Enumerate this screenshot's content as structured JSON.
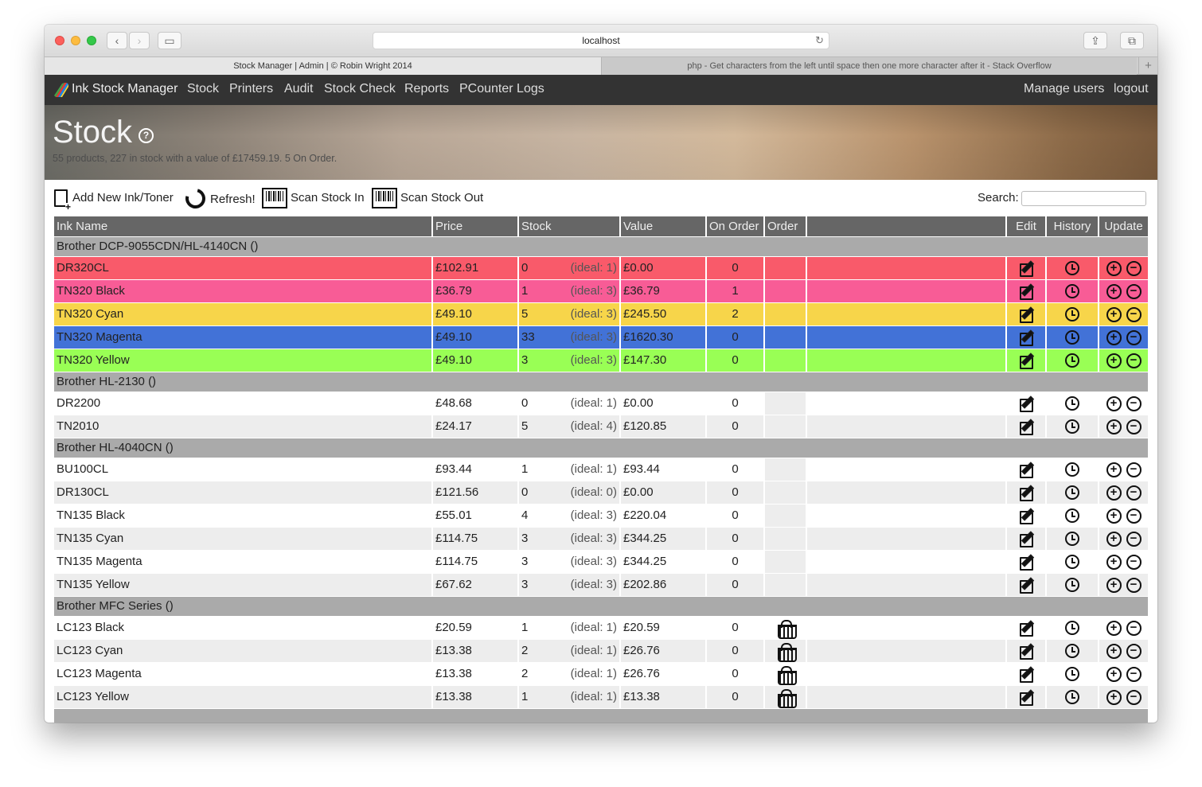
{
  "browser": {
    "url": "localhost",
    "tabs": [
      {
        "label": "Stock Manager | Admin | © Robin Wright 2014",
        "active": true
      },
      {
        "label": "php - Get characters from the left until space then one more character after it - Stack Overflow",
        "active": false
      }
    ]
  },
  "nav": {
    "brand": "Ink Stock Manager",
    "links": [
      "Stock",
      "Printers",
      "Audit",
      "Stock Check",
      "Reports",
      "PCounter Logs"
    ],
    "right_links": [
      "Manage users",
      "logout"
    ]
  },
  "hero": {
    "title": "Stock",
    "help_glyph": "?",
    "summary": "55 products, 227 in stock with a value of £17459.19. 5 On Order."
  },
  "toolbar": {
    "add": "Add New Ink/Toner",
    "refresh": "Refresh!",
    "scan_in": "Scan Stock In",
    "scan_out": "Scan Stock Out",
    "search_label": "Search:",
    "search_value": ""
  },
  "table": {
    "headers": {
      "name": "Ink Name",
      "price": "Price",
      "stock": "Stock",
      "value": "Value",
      "on_order": "On Order",
      "order": "Order",
      "blank": "",
      "edit": "Edit",
      "history": "History",
      "update": "Update"
    },
    "groups": [
      {
        "title": "Brother DCP-9055CDN/HL-4140CN ()",
        "rows": [
          {
            "name": "DR320CL",
            "price": "£102.91",
            "stock": "0",
            "ideal": "(ideal: 1)",
            "value": "£0.00",
            "on_order": "0",
            "color": "#f95a6a",
            "basket": false
          },
          {
            "name": "TN320 Black",
            "price": "£36.79",
            "stock": "1",
            "ideal": "(ideal: 3)",
            "value": "£36.79",
            "on_order": "1",
            "color": "#f85c96",
            "basket": false
          },
          {
            "name": "TN320 Cyan",
            "price": "£49.10",
            "stock": "5",
            "ideal": "(ideal: 3)",
            "value": "£245.50",
            "on_order": "2",
            "color": "#f7d54a",
            "basket": false
          },
          {
            "name": "TN320 Magenta",
            "price": "£49.10",
            "stock": "33",
            "ideal": "(ideal: 3)",
            "value": "£1620.30",
            "on_order": "0",
            "color": "#4272d7",
            "basket": false
          },
          {
            "name": "TN320 Yellow",
            "price": "£49.10",
            "stock": "3",
            "ideal": "(ideal: 3)",
            "value": "£147.30",
            "on_order": "0",
            "color": "#99ff55",
            "basket": false
          }
        ]
      },
      {
        "title": "Brother HL-2130 ()",
        "rows": [
          {
            "name": "DR2200",
            "price": "£48.68",
            "stock": "0",
            "ideal": "(ideal: 1)",
            "value": "£0.00",
            "on_order": "0",
            "color": "#ffffff",
            "basket": false
          },
          {
            "name": "TN2010",
            "price": "£24.17",
            "stock": "5",
            "ideal": "(ideal: 4)",
            "value": "£120.85",
            "on_order": "0",
            "color": "#ededed",
            "basket": false
          }
        ]
      },
      {
        "title": "Brother HL-4040CN ()",
        "rows": [
          {
            "name": "BU100CL",
            "price": "£93.44",
            "stock": "1",
            "ideal": "(ideal: 1)",
            "value": "£93.44",
            "on_order": "0",
            "color": "#ffffff",
            "basket": false
          },
          {
            "name": "DR130CL",
            "price": "£121.56",
            "stock": "0",
            "ideal": "(ideal: 0)",
            "value": "£0.00",
            "on_order": "0",
            "color": "#ededed",
            "basket": false
          },
          {
            "name": "TN135 Black",
            "price": "£55.01",
            "stock": "4",
            "ideal": "(ideal: 3)",
            "value": "£220.04",
            "on_order": "0",
            "color": "#ffffff",
            "basket": false
          },
          {
            "name": "TN135 Cyan",
            "price": "£114.75",
            "stock": "3",
            "ideal": "(ideal: 3)",
            "value": "£344.25",
            "on_order": "0",
            "color": "#ededed",
            "basket": false
          },
          {
            "name": "TN135 Magenta",
            "price": "£114.75",
            "stock": "3",
            "ideal": "(ideal: 3)",
            "value": "£344.25",
            "on_order": "0",
            "color": "#ffffff",
            "basket": false
          },
          {
            "name": "TN135 Yellow",
            "price": "£67.62",
            "stock": "3",
            "ideal": "(ideal: 3)",
            "value": "£202.86",
            "on_order": "0",
            "color": "#ededed",
            "basket": false
          }
        ]
      },
      {
        "title": "Brother MFC Series ()",
        "rows": [
          {
            "name": "LC123 Black",
            "price": "£20.59",
            "stock": "1",
            "ideal": "(ideal: 1)",
            "value": "£20.59",
            "on_order": "0",
            "color": "#ffffff",
            "basket": true
          },
          {
            "name": "LC123 Cyan",
            "price": "£13.38",
            "stock": "2",
            "ideal": "(ideal: 1)",
            "value": "£26.76",
            "on_order": "0",
            "color": "#ededed",
            "basket": true
          },
          {
            "name": "LC123 Magenta",
            "price": "£13.38",
            "stock": "2",
            "ideal": "(ideal: 1)",
            "value": "£26.76",
            "on_order": "0",
            "color": "#ffffff",
            "basket": true
          },
          {
            "name": "LC123 Yellow",
            "price": "£13.38",
            "stock": "1",
            "ideal": "(ideal: 1)",
            "value": "£13.38",
            "on_order": "0",
            "color": "#ededed",
            "basket": true
          }
        ]
      }
    ]
  },
  "icons": {
    "edit": "edit-icon",
    "history": "clock-icon",
    "increase": "plus-circle-icon",
    "decrease": "minus-circle-icon",
    "order": "basket-icon",
    "add": "new-document-icon",
    "refresh": "refresh-icon",
    "scan": "barcode-icon"
  }
}
